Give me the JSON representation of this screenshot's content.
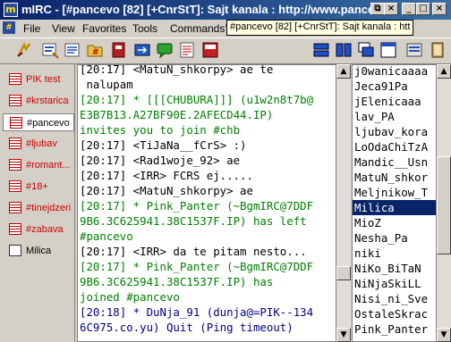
{
  "window": {
    "title": "mIRC - [#pancevo [82] [+CnrStT]: Sajt kanala : http://www.pancevo"
  },
  "menu": [
    "File",
    "View",
    "Favorites",
    "Tools",
    "Commands",
    "W"
  ],
  "tooltip": "#pancevo [82] [+CnrStT]: Sajt kanala : htt",
  "switchbar": [
    {
      "label": "PIK test",
      "type": "status",
      "color": "#cc0000"
    },
    {
      "label": "#krstarica",
      "type": "channel",
      "color": "#cc0000"
    },
    {
      "label": "#pancevo",
      "type": "channel",
      "color": "#000000",
      "active": true
    },
    {
      "label": "#ljubav",
      "type": "channel",
      "color": "#cc0000"
    },
    {
      "label": "#romant...",
      "type": "channel",
      "color": "#cc0000"
    },
    {
      "label": "#18+",
      "type": "channel",
      "color": "#cc0000"
    },
    {
      "label": "#tinejdzeri",
      "type": "channel",
      "color": "#cc0000"
    },
    {
      "label": "#zabava",
      "type": "channel",
      "color": "#cc0000"
    },
    {
      "label": "Milica",
      "type": "query",
      "color": "#000000"
    }
  ],
  "chat_lines": [
    {
      "text": "[20:17] <MatuN_shkorpy> ae te",
      "color": "black"
    },
    {
      "text": " nalupam",
      "color": "black"
    },
    {
      "text": "[20:17] * [[[CHUBURA]]] (u1w2n8t7b@",
      "color": "green"
    },
    {
      "text": "E3B7B13.A27BF90E.2AFECD44.IP)",
      "color": "green"
    },
    {
      "text": "invites you to join #chb",
      "color": "green"
    },
    {
      "text": "[20:17] <TiJaNa__fCrS> :)",
      "color": "black"
    },
    {
      "text": "[20:17] <Rad1woje_92> ae",
      "color": "black"
    },
    {
      "text": "[20:17] <IRR> FCRS ej.....",
      "color": "black"
    },
    {
      "text": "[20:17] <MatuN_shkorpy> ae",
      "color": "black"
    },
    {
      "text": "[20:17] * Pink_Panter (~BgmIRC@7DDF",
      "color": "green"
    },
    {
      "text": "9B6.3C625941.38C1537F.IP) has left",
      "color": "green"
    },
    {
      "text": "#pancevo",
      "color": "green"
    },
    {
      "text": "[20:17] <IRR> da te pitam nesto...",
      "color": "black"
    },
    {
      "text": "[20:17] * Pink_Panter (~BgmIRC@7DDF",
      "color": "green"
    },
    {
      "text": "9B6.3C625941.38C1537F.IP) has",
      "color": "green"
    },
    {
      "text": "joined #pancevo",
      "color": "green"
    },
    {
      "text": "[20:18] * DuNja_91 (dunja@=PIK--134",
      "color": "navy"
    },
    {
      "text": "6C975.co.yu) Quit (Ping timeout)",
      "color": "navy"
    }
  ],
  "nicklist": [
    "j0wanicaaaa",
    "Jeca91Pa",
    "jElenicaaa",
    "lav_PA",
    "ljubav_kora",
    "LoOdaChiTzA",
    "Mandic__Usn",
    "MatuN_shkor",
    "Meljnikow_T",
    "Milica",
    "MioZ",
    "Nesha_Pa",
    "niki",
    "NiKo_BiTaN",
    "NiNjaSkiLL",
    "Nisi_ni_Sve",
    "OstaleSkrac",
    "Pink_Panter"
  ],
  "nicklist_selected": "Milica",
  "toolbar": [
    "connect-icon",
    "options-icon",
    "channel-list-icon",
    "address-book-icon",
    "dcc-send-icon",
    "dcc-chat-icon",
    "notify-icon",
    "urls-icon",
    "tile-icon",
    "cascade-icon",
    "arrange-icon",
    "help-icon"
  ]
}
